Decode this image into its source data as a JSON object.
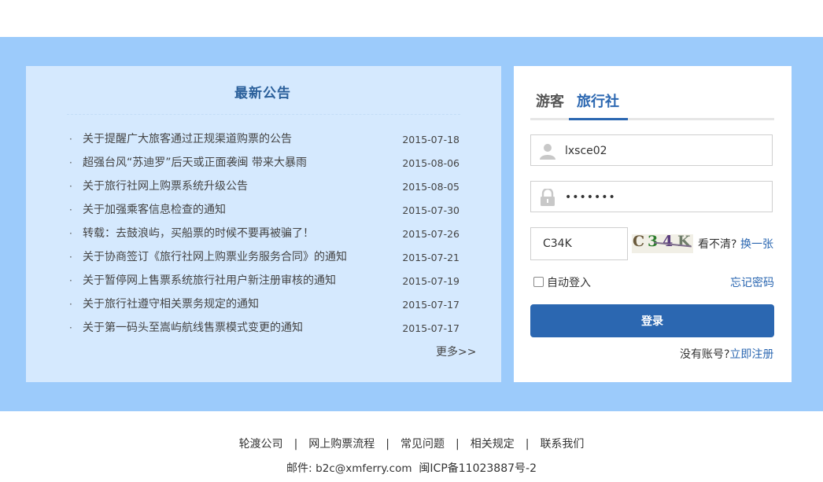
{
  "notice": {
    "title": "最新公告",
    "more": "更多>>",
    "items": [
      {
        "title": "关于提醒广大旅客通过正规渠道购票的公告",
        "date": "2015-07-18"
      },
      {
        "title": "超强台风“苏迪罗”后天或正面袭闽 带来大暴雨",
        "date": "2015-08-06"
      },
      {
        "title": "关于旅行社网上购票系统升级公告",
        "date": "2015-08-05"
      },
      {
        "title": "关于加强乘客信息检查的通知",
        "date": "2015-07-30"
      },
      {
        "title": "转载：去鼓浪屿，买船票的时候不要再被骗了！",
        "date": "2015-07-26"
      },
      {
        "title": "关于协商签订《旅行社网上购票业务服务合同》的通知",
        "date": "2015-07-21"
      },
      {
        "title": "关于暂停网上售票系统旅行社用户新注册审核的通知",
        "date": "2015-07-19"
      },
      {
        "title": "关于旅行社遵守相关票务规定的通知",
        "date": "2015-07-17"
      },
      {
        "title": "关于第一码头至嵩屿航线售票模式变更的通知",
        "date": "2015-07-17"
      }
    ]
  },
  "login": {
    "tabs": [
      {
        "label": "游客",
        "active": false
      },
      {
        "label": "旅行社",
        "active": true
      }
    ],
    "username": {
      "value": "lxsce02",
      "icon": "user-icon"
    },
    "password": {
      "value": "•••••••",
      "icon": "lock-icon"
    },
    "captcha": {
      "value": "C34K",
      "image_text": [
        "C",
        "3",
        "4",
        "K"
      ],
      "hint": "看不清?",
      "change": "换一张"
    },
    "auto_login": {
      "label": "自动登入",
      "checked": false
    },
    "forgot": "忘记密码",
    "submit": "登录",
    "register_prompt": "没有账号?",
    "register_link": "立即注册"
  },
  "footer": {
    "links": [
      "轮渡公司",
      "网上购票流程",
      "常见问题",
      "相关规定",
      "联系我们"
    ],
    "separator": "|",
    "email_label": "邮件:",
    "email": "b2c@xmferry.com",
    "icp": "闽ICP备11023887号-2"
  },
  "colors": {
    "band": "#9ccbfb",
    "notice_bg": "#d5e9fe",
    "accent": "#2b67b1"
  }
}
